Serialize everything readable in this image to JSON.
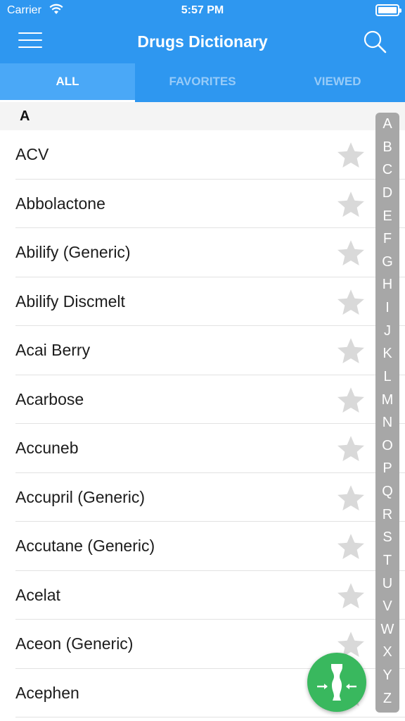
{
  "status_bar": {
    "carrier": "Carrier",
    "time": "5:57 PM"
  },
  "navbar": {
    "title": "Drugs Dictionary",
    "menu_icon": "hamburger-icon",
    "search_icon": "search-icon"
  },
  "tabs": [
    {
      "label": "ALL",
      "active": true
    },
    {
      "label": "FAVORITES",
      "active": false
    },
    {
      "label": "VIEWED",
      "active": false
    }
  ],
  "section": {
    "letter": "A"
  },
  "drugs": [
    {
      "name": "ACV"
    },
    {
      "name": "Abbolactone"
    },
    {
      "name": "Abilify (Generic)"
    },
    {
      "name": "Abilify Discmelt"
    },
    {
      "name": "Acai Berry"
    },
    {
      "name": "Acarbose"
    },
    {
      "name": "Accuneb"
    },
    {
      "name": "Accupril (Generic)"
    },
    {
      "name": "Accutane (Generic)"
    },
    {
      "name": "Acelat"
    },
    {
      "name": "Aceon (Generic)"
    },
    {
      "name": "Acephen"
    }
  ],
  "index_letters": [
    "A",
    "B",
    "C",
    "D",
    "E",
    "F",
    "G",
    "H",
    "I",
    "J",
    "K",
    "L",
    "M",
    "N",
    "O",
    "P",
    "Q",
    "R",
    "S",
    "T",
    "U",
    "V",
    "W",
    "X",
    "Y",
    "Z"
  ],
  "fab": {
    "icon": "body-measure-icon"
  },
  "colors": {
    "primary": "#2e97f0",
    "active_tab": "#4aa8f7",
    "fab": "#39b85e",
    "star": "#d6d6d6",
    "index_bar": "#a7a7a7"
  }
}
